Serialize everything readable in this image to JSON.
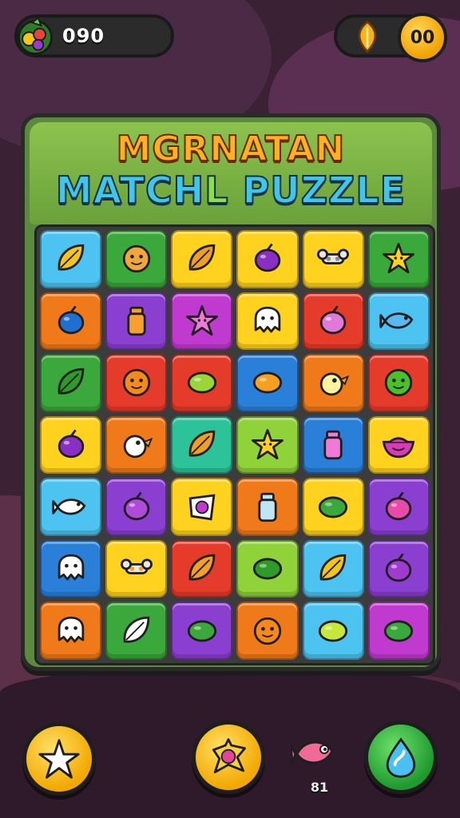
{
  "hud": {
    "score_value": "090",
    "score_icon": "fruit-bundle-icon",
    "coin_icon": "golden-leaf-icon",
    "coin_value": "00"
  },
  "title": {
    "line1": "MGRNATAN",
    "line2_part1": "MATCH",
    "line2_part2": "L",
    "line2_part3": " PUZZLE"
  },
  "colors": {
    "sky": "#4cc3f0",
    "green": "#3aa83a",
    "yellow": "#ffd21f",
    "purple": "#8a3fd1",
    "orange": "#f07a1a",
    "red": "#e53b2a",
    "magenta": "#c13ad0",
    "teal": "#2cc39a",
    "blue": "#2a7fd8",
    "lime": "#8fd23a"
  },
  "board": {
    "rows": [
      [
        {
          "bg": "sky",
          "icon": "leaf",
          "c": "#f5c518"
        },
        {
          "bg": "green",
          "icon": "face",
          "c": "#f0a63a"
        },
        {
          "bg": "yellow",
          "icon": "leaf",
          "c": "#f0a020"
        },
        {
          "bg": "yellow",
          "icon": "berry",
          "c": "#8a2fc4"
        },
        {
          "bg": "yellow",
          "icon": "bone",
          "c": "#8a8a8a"
        },
        {
          "bg": "green",
          "icon": "star",
          "c": "#ffd21f"
        }
      ],
      [
        {
          "bg": "orange",
          "icon": "berry",
          "c": "#1f6fd1"
        },
        {
          "bg": "purple",
          "icon": "jar",
          "c": "#f5a030"
        },
        {
          "bg": "magenta",
          "icon": "star",
          "c": "#f07ad8"
        },
        {
          "bg": "yellow",
          "icon": "ghost",
          "c": "#ffffff"
        },
        {
          "bg": "red",
          "icon": "berry",
          "c": "#e07ad8"
        },
        {
          "bg": "sky",
          "icon": "fish",
          "c": "#5ab8f0"
        }
      ],
      [
        {
          "bg": "green",
          "icon": "leaf",
          "c": "#2e9a2a"
        },
        {
          "bg": "red",
          "icon": "face",
          "c": "#f58a1a"
        },
        {
          "bg": "red",
          "icon": "lemon",
          "c": "#9ad63a"
        },
        {
          "bg": "blue",
          "icon": "lemon",
          "c": "#f5a020"
        },
        {
          "bg": "orange",
          "icon": "chick",
          "c": "#fff2a0"
        },
        {
          "bg": "red",
          "icon": "face",
          "c": "#4ac12a"
        }
      ],
      [
        {
          "bg": "yellow",
          "icon": "berry",
          "c": "#8a2fc4"
        },
        {
          "bg": "orange",
          "icon": "chick",
          "c": "#ffffff"
        },
        {
          "bg": "teal",
          "icon": "leaf",
          "c": "#f0a020"
        },
        {
          "bg": "lime",
          "icon": "star",
          "c": "#ffd21f"
        },
        {
          "bg": "blue",
          "icon": "jar",
          "c": "#f07ad8"
        },
        {
          "bg": "yellow",
          "icon": "bowl",
          "c": "#d83ab8"
        }
      ],
      [
        {
          "bg": "sky",
          "icon": "fish",
          "c": "#ffffff"
        },
        {
          "bg": "purple",
          "icon": "berry",
          "c": "#b04ad8"
        },
        {
          "bg": "yellow",
          "icon": "gem",
          "c": "#c13ad0"
        },
        {
          "bg": "orange",
          "icon": "jar",
          "c": "#bfe6f5"
        },
        {
          "bg": "yellow",
          "icon": "lemon",
          "c": "#3aa83a"
        },
        {
          "bg": "purple",
          "icon": "berry",
          "c": "#e84aa8"
        }
      ],
      [
        {
          "bg": "blue",
          "icon": "ghost",
          "c": "#ffffff"
        },
        {
          "bg": "yellow",
          "icon": "bone",
          "c": "#f0a020"
        },
        {
          "bg": "red",
          "icon": "leaf",
          "c": "#f5a020"
        },
        {
          "bg": "lime",
          "icon": "lemon",
          "c": "#2e9a2a"
        },
        {
          "bg": "sky",
          "icon": "leaf",
          "c": "#f5c518"
        },
        {
          "bg": "purple",
          "icon": "berry",
          "c": "#a03ad0"
        }
      ],
      [
        {
          "bg": "orange",
          "icon": "ghost",
          "c": "#ffffff"
        },
        {
          "bg": "green",
          "icon": "leaf",
          "c": "#ffffff"
        },
        {
          "bg": "purple",
          "icon": "lemon",
          "c": "#3aa83a"
        },
        {
          "bg": "orange",
          "icon": "face",
          "c": "#f58a1a"
        },
        {
          "bg": "sky",
          "icon": "lemon",
          "c": "#c6e83a"
        },
        {
          "bg": "magenta",
          "icon": "lemon",
          "c": "#3aa83a"
        }
      ]
    ]
  },
  "controls": {
    "star_button_icon": "star-icon",
    "bomb_button_icon": "gem-blast-icon",
    "fish_icon": "pink-fish-icon",
    "fish_count": "81",
    "swap_button_icon": "water-drop-icon"
  }
}
